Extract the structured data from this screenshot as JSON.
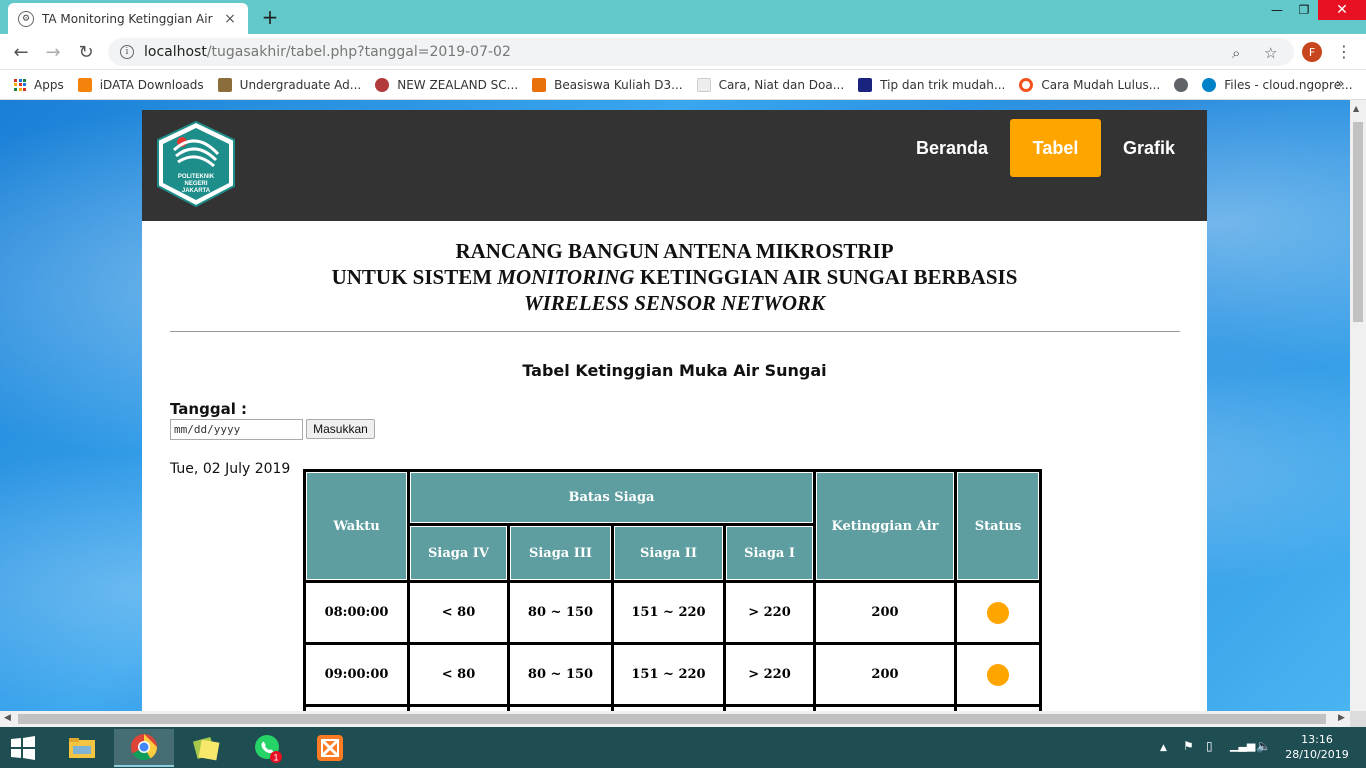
{
  "browser": {
    "tab_title": "TA Monitoring Ketinggian Air",
    "tab_close": "×",
    "new_tab": "+",
    "window_min": "—",
    "window_max": "❐",
    "window_close": "✕",
    "back": "←",
    "forward": "→",
    "reload": "↻",
    "url_host": "localhost",
    "url_path": "/tugasakhir/tabel.php?tanggal=2019-07-02",
    "zoom_icon": "⌕",
    "star_icon": "☆",
    "profile_initial": "F",
    "menu_icon": "⋮",
    "bookmarks": [
      {
        "label": "Apps",
        "color": "#d93025"
      },
      {
        "label": "iDATA Downloads",
        "color": "#f5820b"
      },
      {
        "label": "Undergraduate Ad...",
        "color": "#8a6d3b"
      },
      {
        "label": "NEW ZEALAND SC...",
        "color": "#b23a3a"
      },
      {
        "label": "Beasiswa Kuliah D3...",
        "color": "#e8710a"
      },
      {
        "label": "Cara, Niat dan Doa...",
        "color": "#e0e0e0"
      },
      {
        "label": "Tip dan trik mudah...",
        "color": "#1a237e"
      },
      {
        "label": "Cara Mudah Lulus...",
        "color": "#f4511e"
      },
      {
        "label": "",
        "color": "#5f6368"
      },
      {
        "label": "Files - cloud.ngopre...",
        "color": "#0082c9"
      }
    ],
    "bookmarks_more": "»"
  },
  "site": {
    "logo_text": [
      "POLITEKNIK",
      "NEGERI",
      "JAKARTA"
    ],
    "nav": [
      {
        "label": "Beranda",
        "active": false
      },
      {
        "label": "Tabel",
        "active": true
      },
      {
        "label": "Grafik",
        "active": false
      }
    ],
    "title_line1": "RANCANG BANGUN ANTENA MIKROSTRIP",
    "title_line2_a": "UNTUK SISTEM ",
    "title_line2_b": "MONITORING",
    "title_line2_c": " KETINGGIAN AIR SUNGAI BERBASIS",
    "title_line3": "WIRELESS SENSOR NETWORK",
    "section_title": "Tabel Ketinggian Muka Air Sungai",
    "date_label": "Tanggal :",
    "date_placeholder": "mm/dd/yyyy",
    "submit_label": "Masukkan",
    "date_display": "Tue, 02 July 2019"
  },
  "table": {
    "headers": {
      "waktu": "Waktu",
      "batas_siaga": "Batas Siaga",
      "siaga_iv": "Siaga IV",
      "siaga_iii": "Siaga III",
      "siaga_ii": "Siaga II",
      "siaga_i": "Siaga I",
      "ketinggian": "Ketinggian Air",
      "status": "Status"
    },
    "status_color": "#ffa500",
    "rows": [
      {
        "waktu": "08:00:00",
        "siaga_iv": "< 80",
        "siaga_iii": "80 ~ 150",
        "siaga_ii": "151 ~ 220",
        "siaga_i": "> 220",
        "ketinggian": "200"
      },
      {
        "waktu": "09:00:00",
        "siaga_iv": "< 80",
        "siaga_iii": "80 ~ 150",
        "siaga_ii": "151 ~ 220",
        "siaga_i": "> 220",
        "ketinggian": "200"
      }
    ]
  },
  "taskbar": {
    "time": "13:16",
    "date": "28/10/2019",
    "whatsapp_badge": "1"
  }
}
